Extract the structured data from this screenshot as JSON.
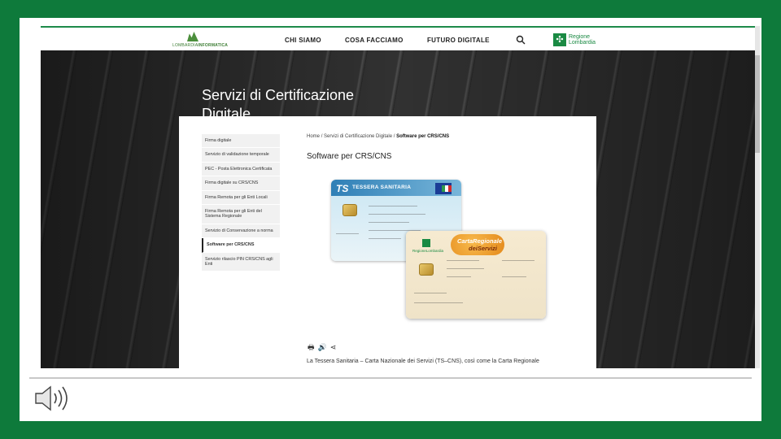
{
  "header": {
    "logo_text_light": "LOMBARDIA",
    "logo_text_bold": "INFORMATICA",
    "nav": [
      {
        "label": "CHI SIAMO"
      },
      {
        "label": "COSA FACCIAMO"
      },
      {
        "label": "FUTURO DIGITALE"
      }
    ],
    "search_icon": "search-icon",
    "region_line1": "Regione",
    "region_line2": "Lombardia"
  },
  "hero": {
    "title": "Servizi di Certificazione Digitale"
  },
  "sidebar": {
    "items": [
      {
        "label": "Firma digitale"
      },
      {
        "label": "Servizio di validazione temporale"
      },
      {
        "label": "PEC - Posta Elettronica Certificata"
      },
      {
        "label": "Firma digitale su CRS/CNS"
      },
      {
        "label": "Firma Remota per gli Enti Locali"
      },
      {
        "label": "Firma Remota per gli Enti del Sistema Regionale"
      },
      {
        "label": "Servizio di Conservazione a norma"
      },
      {
        "label": "Software per CRS/CNS"
      },
      {
        "label": "Servizio rilascio PIN CRS/CNS agli Enti"
      }
    ],
    "active_index": 7
  },
  "breadcrumb": {
    "home": "Home",
    "section": "Servizi di Certificazione Digitale",
    "current": "Software per CRS/CNS",
    "separator": "/"
  },
  "page": {
    "title": "Software per CRS/CNS",
    "intro": "La Tessera Sanitaria – Carta Nazionale dei Servizi (TS–CNS), così come la Carta Regionale"
  },
  "cards": {
    "ts_logo": "TS",
    "ts_title": "TESSERA SANITARIA",
    "crs_title_a": "CartaRegionale",
    "crs_title_b": "deiServizi",
    "crs_region": "RegioneLombardia"
  },
  "tools": {
    "print_icon": "print-icon",
    "audio_icon": "audio-icon",
    "share_icon": "share-icon"
  },
  "slide": {
    "speaker_icon": "speaker-icon",
    "frame_color": "#0e7a3b"
  }
}
